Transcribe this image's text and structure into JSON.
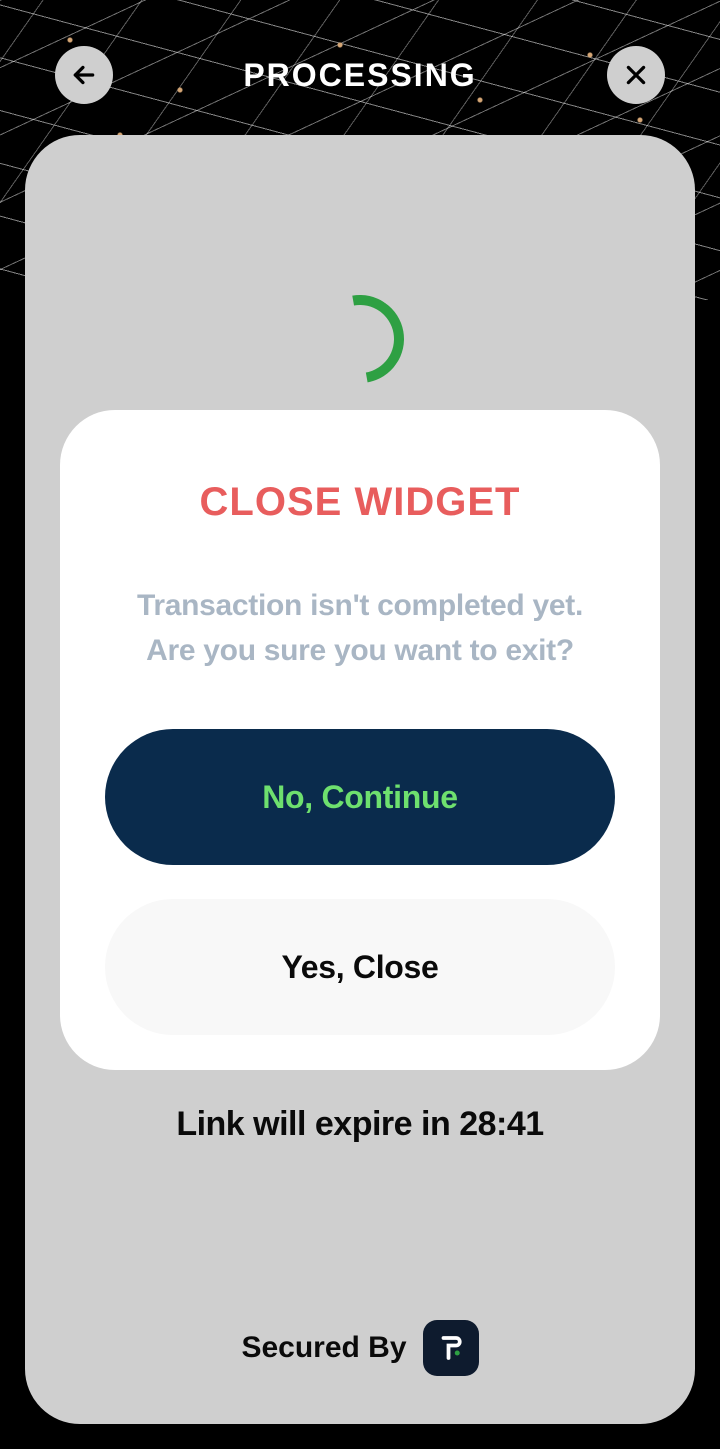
{
  "header": {
    "title": "PROCESSING"
  },
  "modal": {
    "title": "CLOSE WIDGET",
    "line1": "Transaction isn't completed yet.",
    "line2": "Are you sure you want to exit?",
    "continue_label": "No, Continue",
    "close_label": "Yes, Close"
  },
  "expire": {
    "prefix": "Link will expire in ",
    "time": "28:41"
  },
  "footer": {
    "secured_label": "Secured By"
  }
}
